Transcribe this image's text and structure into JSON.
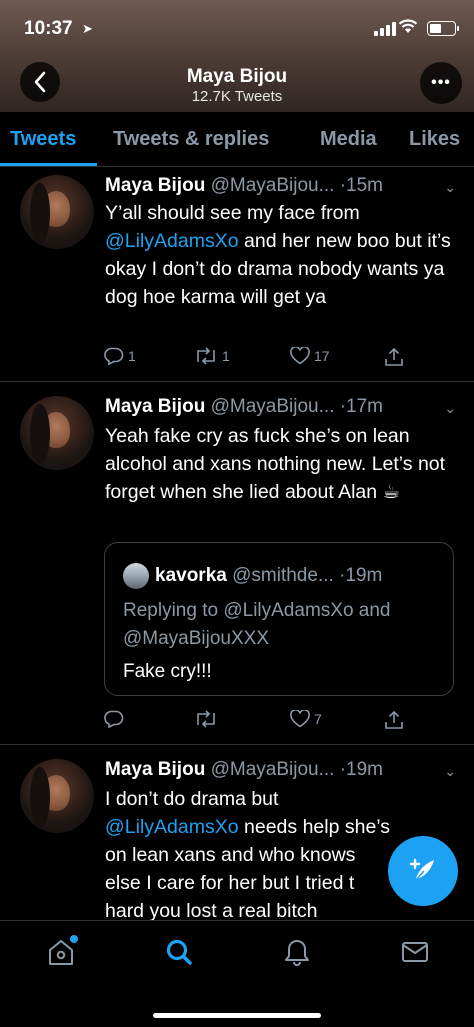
{
  "status": {
    "time": "10:37",
    "location_icon": "location-arrow-icon"
  },
  "profile": {
    "name": "Maya Bijou",
    "tweet_count": "12.7K Tweets"
  },
  "tabs": [
    {
      "label": "Tweets",
      "active": true
    },
    {
      "label": "Tweets & replies",
      "active": false
    },
    {
      "label": "Media",
      "active": false
    },
    {
      "label": "Likes",
      "active": false
    }
  ],
  "tweets": [
    {
      "name": "Maya Bijou",
      "handle": "@MayaBijou...",
      "time": "·15m",
      "text_before": "Y’all should see my face from ",
      "mention": "@LilyAdamsXo",
      "text_after": " and her new boo but it’s okay I don’t do drama nobody wants ya dog hoe karma will get ya",
      "replies": "1",
      "retweets": "1",
      "likes": "17"
    },
    {
      "name": "Maya Bijou",
      "handle": "@MayaBijou...",
      "time": "·17m",
      "text": "Yeah fake cry as fuck she’s on lean alcohol and xans nothing new. Let’s not forget when she lied about Alan ☕",
      "quote": {
        "name": "kavorka",
        "handle": "@smithde...",
        "time": "·19m",
        "reply_to": "Replying to @LilyAdamsXo and @MayaBijouXXX",
        "text": "Fake cry!!!"
      },
      "replies": "",
      "retweets": "",
      "likes": "7"
    },
    {
      "name": "Maya Bijou",
      "handle": "@MayaBijou...",
      "time": "·19m",
      "line1": "I don’t do drama but",
      "mention": "@LilyAdamsXo",
      "line2_after": " needs help she’s",
      "line3": "on lean xans and who knows",
      "line4": "else I care for her but I tried t",
      "line5": "hard you lost a real bitch"
    }
  ],
  "colors": {
    "accent": "#1da1f2",
    "muted": "#8b98a5",
    "background": "#000000"
  }
}
